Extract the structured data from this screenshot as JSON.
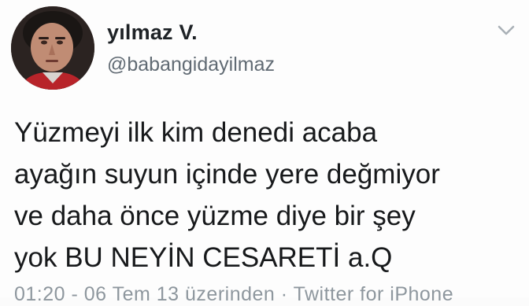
{
  "tweet": {
    "author": {
      "display_name": "yılmaz V.",
      "handle": "@babangidayilmaz",
      "avatar_icon": "profile-photo"
    },
    "menu_icon": "chevron-down-icon",
    "text_lines": [
      "Yüzmeyi ilk kim denedi acaba",
      "ayağın suyun içinde yere değmiyor",
      "ve daha önce yüzme diye bir şey",
      "yok BU NEYİN CESARETİ a.Q"
    ],
    "meta": "01:20 - 06 Tem 13 üzerinden · Twitter for iPhone"
  }
}
